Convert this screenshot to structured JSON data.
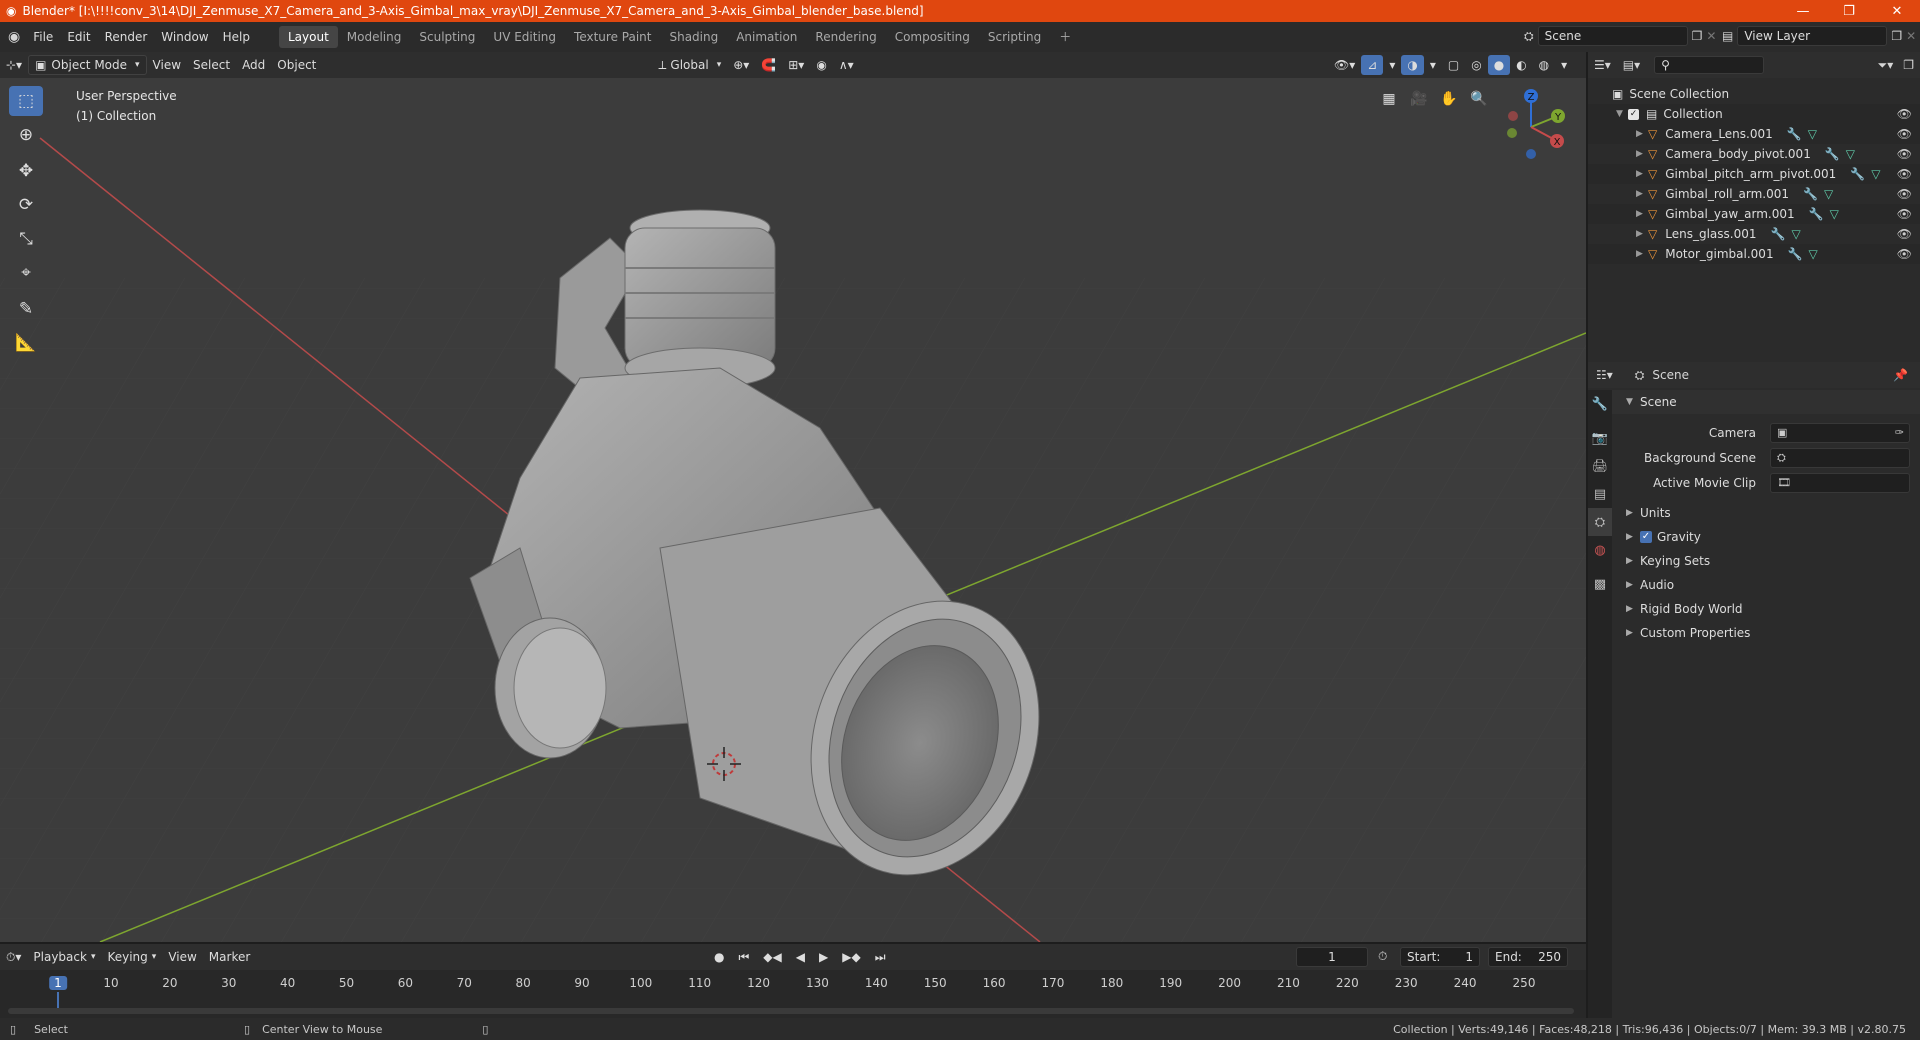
{
  "window": {
    "title": "Blender* [I:\\!!!!conv_3\\14\\DJI_Zenmuse_X7_Camera_and_3-Axis_Gimbal_max_vray\\DJI_Zenmuse_X7_Camera_and_3-Axis_Gimbal_blender_base.blend]"
  },
  "menu": [
    "File",
    "Edit",
    "Render",
    "Window",
    "Help"
  ],
  "workspaces": [
    "Layout",
    "Modeling",
    "Sculpting",
    "UV Editing",
    "Texture Paint",
    "Shading",
    "Animation",
    "Rendering",
    "Compositing",
    "Scripting"
  ],
  "scene_field": "Scene",
  "view_layer_field": "View Layer",
  "viewport_header": {
    "mode": "Object Mode",
    "view": "View",
    "select": "Select",
    "add": "Add",
    "object": "Object",
    "transform": "Global"
  },
  "viewport": {
    "perspective": "User Perspective",
    "collection": "(1) Collection"
  },
  "gizmo": {
    "x": "X",
    "y": "Y",
    "z": "Z"
  },
  "outliner": {
    "root": "Scene Collection",
    "collection": "Collection",
    "objects": [
      "Camera_Lens.001",
      "Camera_body_pivot.001",
      "Gimbal_pitch_arm_pivot.001",
      "Gimbal_roll_arm.001",
      "Gimbal_yaw_arm.001",
      "Lens_glass.001",
      "Motor_gimbal.001"
    ]
  },
  "properties": {
    "header": "Scene",
    "section": "Scene",
    "fields": [
      {
        "label": "Camera"
      },
      {
        "label": "Background Scene"
      },
      {
        "label": "Active Movie Clip"
      }
    ],
    "subsections": [
      "Units",
      "Gravity",
      "Keying Sets",
      "Audio",
      "Rigid Body World",
      "Custom Properties"
    ]
  },
  "timeline": {
    "playback": "Playback",
    "keying": "Keying",
    "view": "View",
    "marker": "Marker",
    "current_frame": "1",
    "start_label": "Start:",
    "start": "1",
    "end_label": "End:",
    "end": "250",
    "ticks": [
      "1",
      "10",
      "20",
      "30",
      "40",
      "50",
      "60",
      "70",
      "80",
      "90",
      "100",
      "110",
      "120",
      "130",
      "140",
      "150",
      "160",
      "170",
      "180",
      "190",
      "200",
      "210",
      "220",
      "230",
      "240",
      "250"
    ]
  },
  "status": {
    "left": "Select",
    "middle": "Center View to Mouse",
    "right": "Collection | Verts:49,146 | Faces:48,218 | Tris:96,436 | Objects:0/7 | Mem: 39.3 MB | v2.80.75"
  },
  "colors": {
    "accent": "#4772b3",
    "titlebar": "#e0470f",
    "x_axis": "#c54b4b",
    "y_axis": "#7ea62f",
    "z_axis": "#2f6fd6"
  }
}
